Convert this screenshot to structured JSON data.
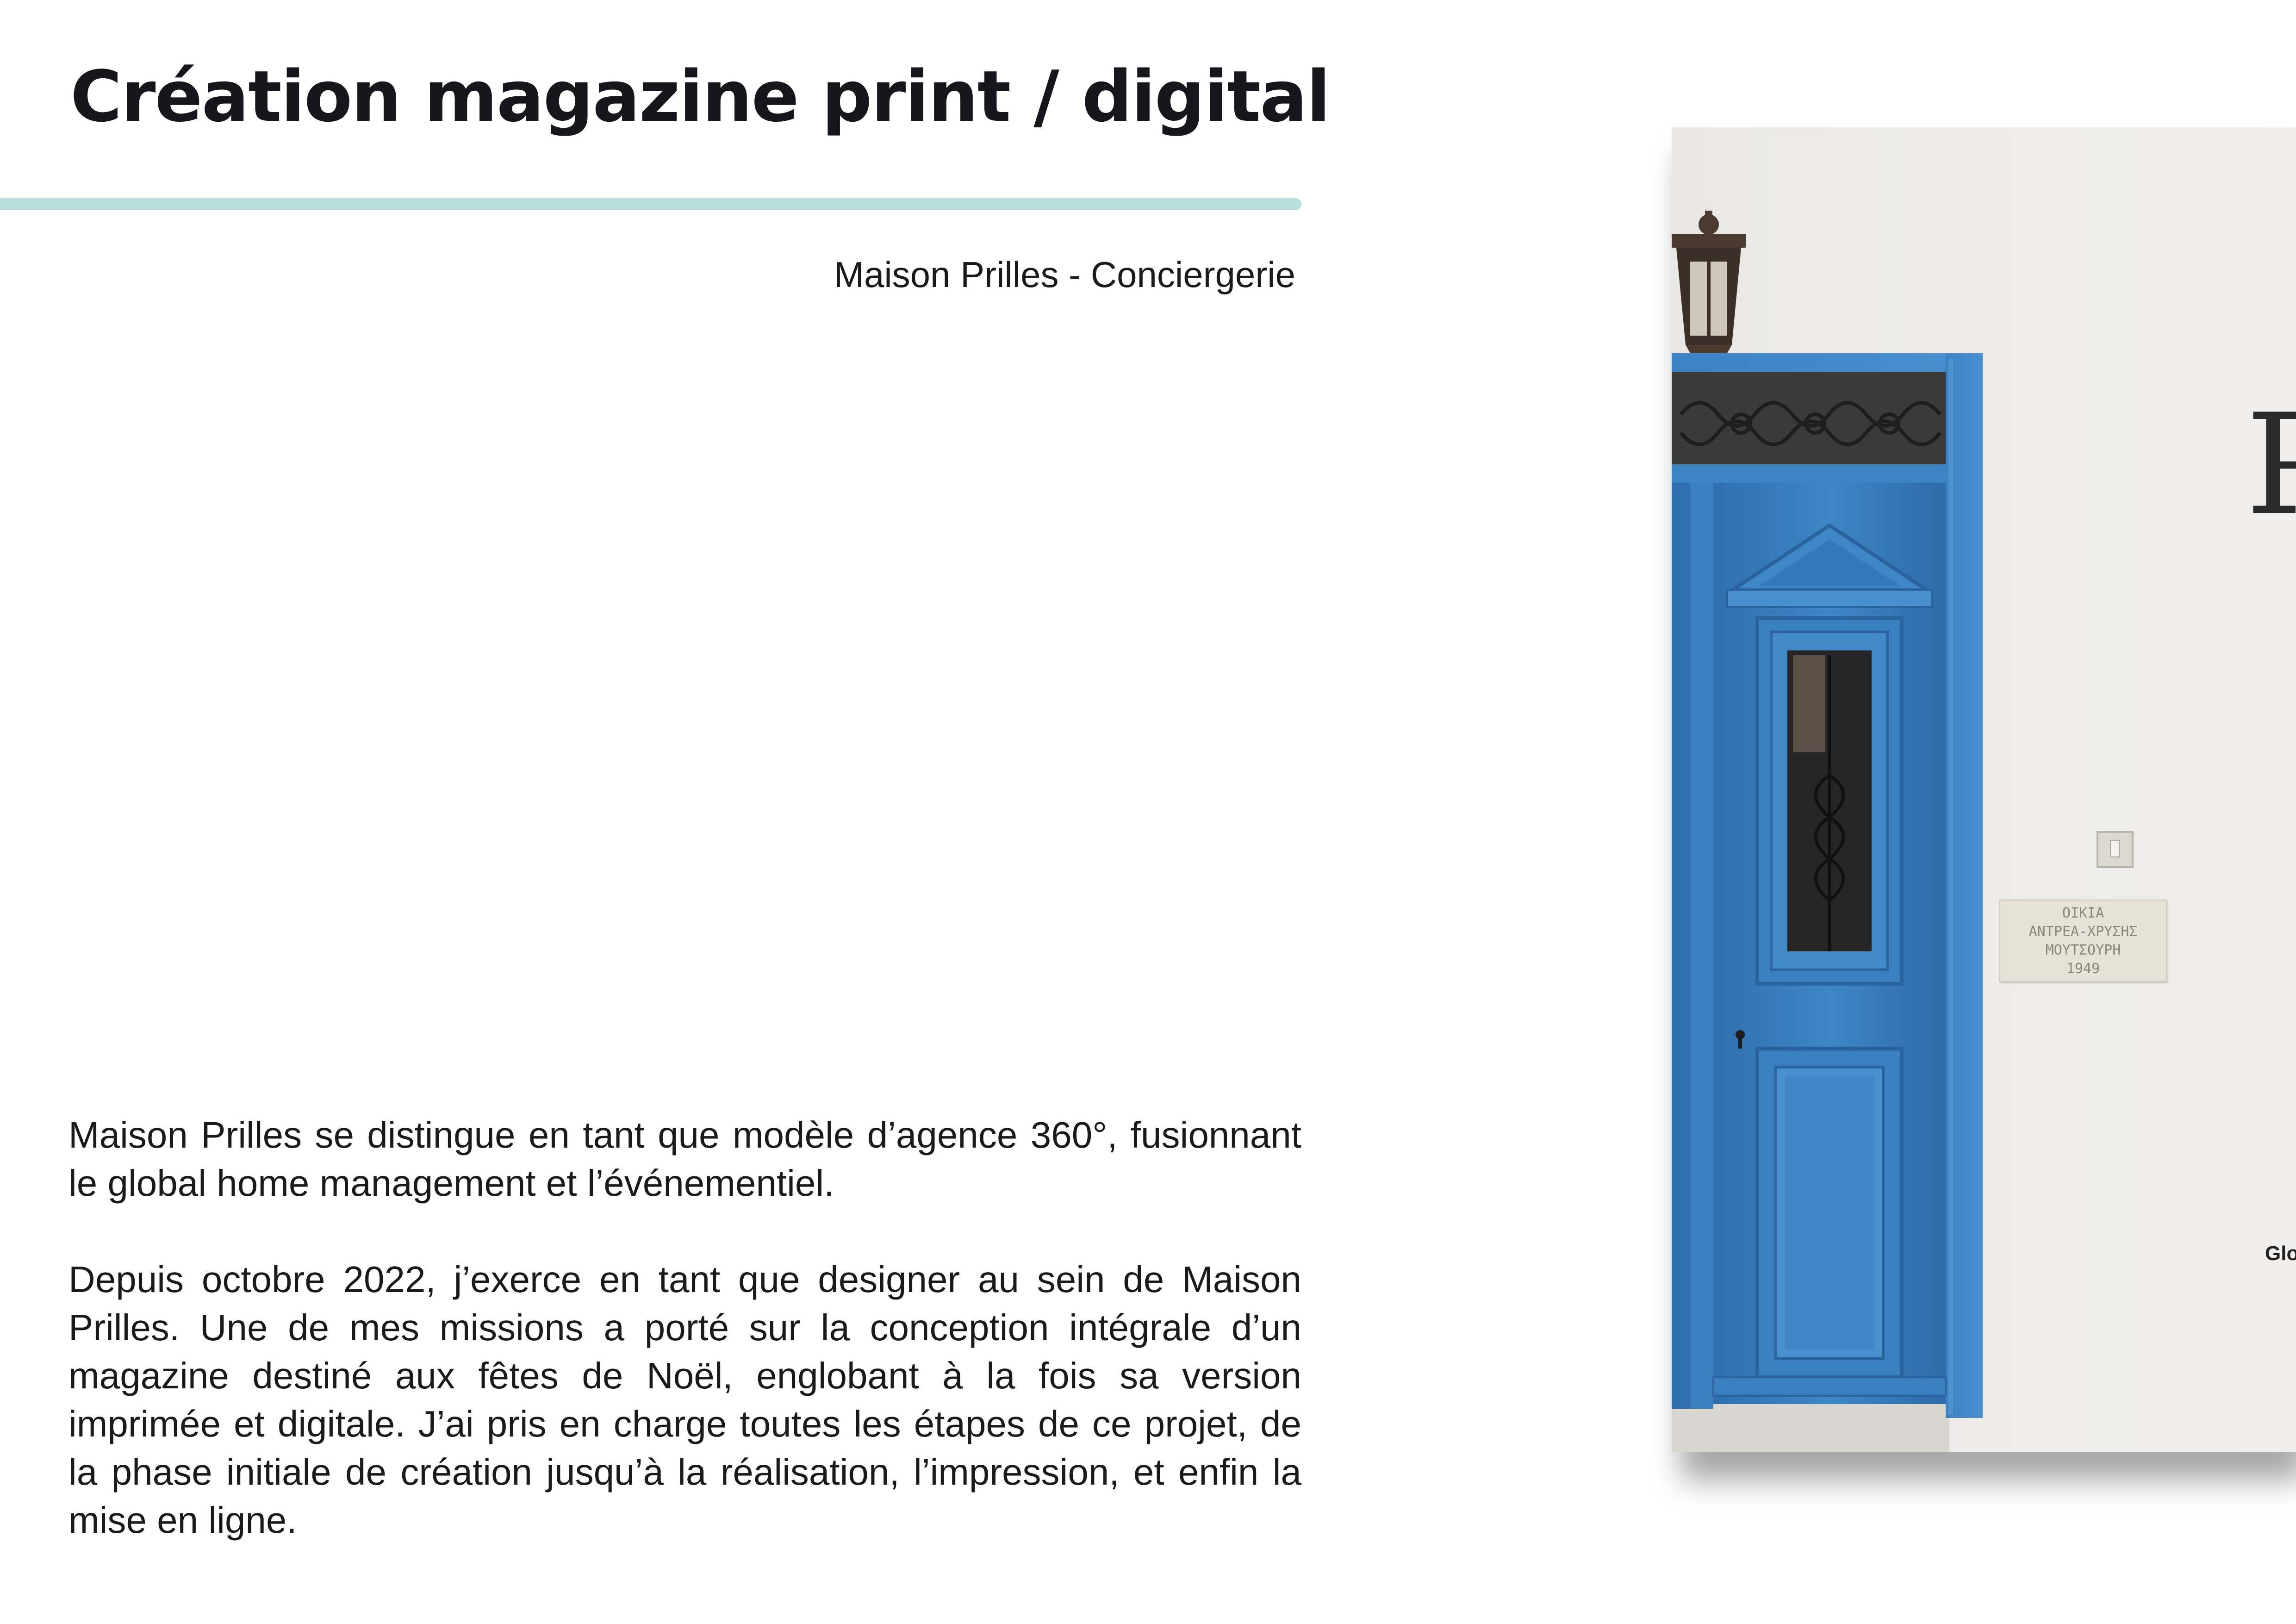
{
  "header": {
    "title": "Création magazine print / digital",
    "accent_color": "#b9e0dd"
  },
  "client": {
    "name": "Maison Prilles - Conciergerie"
  },
  "description": {
    "paragraphs": [
      "Maison Prilles se distingue en tant que modèle d’agence 360°, fusionnant le global home management et l’événementiel.",
      "Depuis octobre 2022, j’exerce en tant que designer au sein de Maison Prilles. Une de mes missions a porté sur la conception intégrale d’un magazine destiné aux fêtes de Noël, englobant à la fois sa version imprimée et digitale. J’ai pris en charge toutes les étapes de ce projet, de la phase initiale de création jusqu’à la réalisation, l’impression, et enfin la mise en ligne."
    ]
  },
  "magazine_cover": {
    "title_glyph": "P",
    "plaque_lines": [
      "ΟΙΚΙΑ",
      "ΑΝΤΡΕΑ-ΧΡΥΣΗΣ",
      "ΜΟΥΤΣΟΥΡΗ",
      "1949"
    ],
    "footer_text": "Glo",
    "door_color": "#3a7fc0"
  }
}
